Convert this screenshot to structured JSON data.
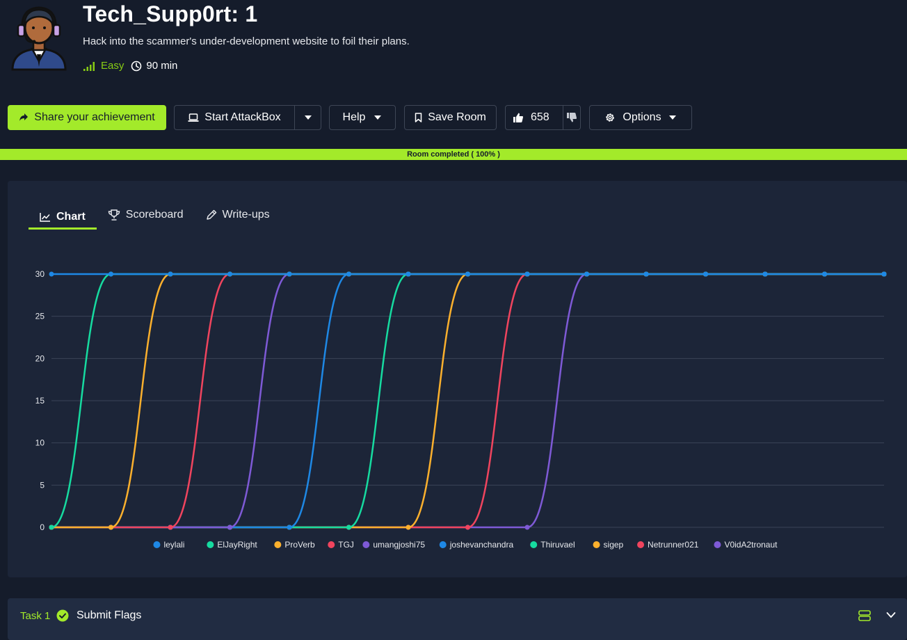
{
  "room": {
    "title": "Tech_Supp0rt: 1",
    "description": "Hack into the scammer's under-development website to foil their plans.",
    "difficulty": "Easy",
    "duration": "90 min"
  },
  "toolbar": {
    "share_label": "Share your achievement",
    "attackbox_label": "Start AttackBox",
    "help_label": "Help",
    "save_label": "Save Room",
    "likes": "658",
    "options_label": "Options"
  },
  "progress": {
    "label": "Room completed ( 100% )",
    "value": 1.0
  },
  "tabs": [
    {
      "label": "Chart",
      "active": true
    },
    {
      "label": "Scoreboard",
      "active": false
    },
    {
      "label": "Write-ups",
      "active": false
    }
  ],
  "chart_data": {
    "type": "line",
    "ylim": [
      0,
      30
    ],
    "yticks": [
      "0",
      "5",
      "10",
      "15",
      "20",
      "25",
      "30"
    ],
    "x": [
      1,
      2,
      3,
      4,
      5,
      6,
      7,
      8,
      9,
      10,
      11,
      12,
      13,
      14,
      15
    ],
    "grid": true,
    "legend": "bottom",
    "series": [
      {
        "name": "leylali",
        "color": "#1e88e5",
        "values": [
          30,
          30,
          30,
          30,
          30,
          30,
          30,
          30,
          30,
          30,
          30,
          30,
          30,
          30,
          30
        ]
      },
      {
        "name": "ElJayRight",
        "color": "#16dba0",
        "values": [
          0,
          30,
          30,
          30,
          30,
          30,
          30,
          30,
          30,
          30,
          30,
          30,
          30,
          30,
          30
        ]
      },
      {
        "name": "ProVerb",
        "color": "#fbb02d",
        "values": [
          0,
          0,
          30,
          30,
          30,
          30,
          30,
          30,
          30,
          30,
          30,
          30,
          30,
          30,
          30
        ]
      },
      {
        "name": "TGJ",
        "color": "#f0445e",
        "values": [
          0,
          0,
          0,
          30,
          30,
          30,
          30,
          30,
          30,
          30,
          30,
          30,
          30,
          30,
          30
        ]
      },
      {
        "name": "umangjoshi75",
        "color": "#7e5ad6",
        "values": [
          0,
          0,
          0,
          0,
          30,
          30,
          30,
          30,
          30,
          30,
          30,
          30,
          30,
          30,
          30
        ]
      },
      {
        "name": "joshevanchandra",
        "color": "#1e88e5",
        "values": [
          0,
          0,
          0,
          0,
          0,
          30,
          30,
          30,
          30,
          30,
          30,
          30,
          30,
          30,
          30
        ]
      },
      {
        "name": "Thiruvael",
        "color": "#16dba0",
        "values": [
          0,
          0,
          0,
          0,
          0,
          0,
          30,
          30,
          30,
          30,
          30,
          30,
          30,
          30,
          30
        ]
      },
      {
        "name": "sigep",
        "color": "#fbb02d",
        "values": [
          0,
          0,
          0,
          0,
          0,
          0,
          0,
          30,
          30,
          30,
          30,
          30,
          30,
          30,
          30
        ]
      },
      {
        "name": "Netrunner021",
        "color": "#f0445e",
        "values": [
          0,
          0,
          0,
          0,
          0,
          0,
          0,
          0,
          30,
          30,
          30,
          30,
          30,
          30,
          30
        ]
      },
      {
        "name": "V0idA2tronaut",
        "color": "#7e5ad6",
        "values": [
          0,
          0,
          0,
          0,
          0,
          0,
          0,
          0,
          0,
          30,
          30,
          30,
          30,
          30,
          30
        ]
      }
    ]
  },
  "task": {
    "label": "Task 1",
    "name": "Submit Flags"
  },
  "colors": {
    "accent": "#a3ea2a",
    "background": "#151c2b",
    "panel": "#1c2538"
  }
}
